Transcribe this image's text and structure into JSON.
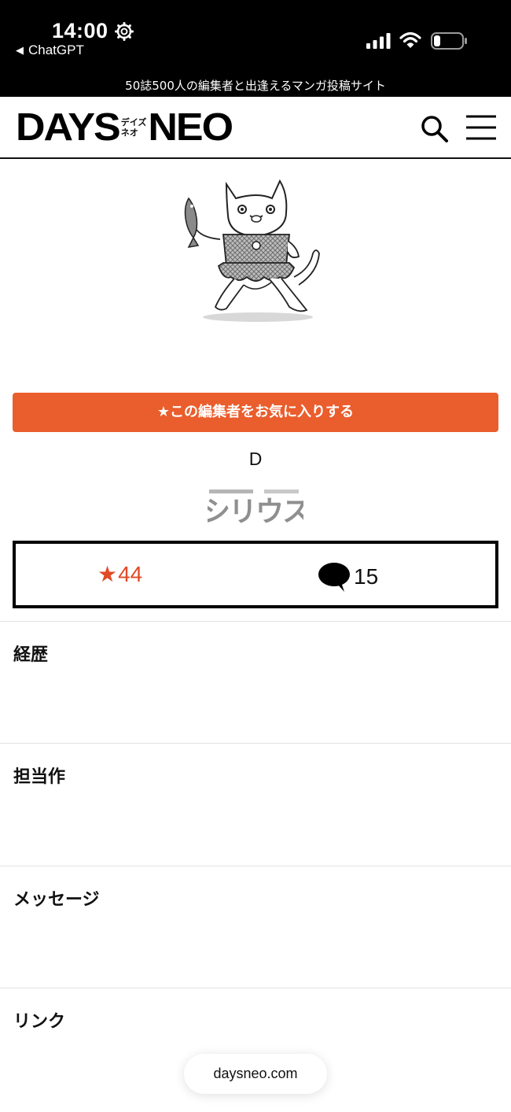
{
  "status_bar": {
    "time": "14:00",
    "back_app": "ChatGPT",
    "icons": [
      "gear-icon",
      "signal-icon",
      "wifi-icon",
      "battery-icon"
    ]
  },
  "site": {
    "tagline": "50誌500人の編集者と出逢えるマンガ投稿サイト",
    "logo_left": "DAYS",
    "logo_kana_top": "デイズ",
    "logo_kana_bottom": "ネオ",
    "logo_right": "NEO"
  },
  "editor": {
    "favorite_button_label": "★この編集者をお気に入りする",
    "name": "D",
    "magazine_logo": "シリウス",
    "favorites_count": "44",
    "comments_count": "15"
  },
  "sections": [
    {
      "title": "経歴"
    },
    {
      "title": "担当作"
    },
    {
      "title": "メッセージ"
    },
    {
      "title": "リンク"
    }
  ],
  "browser": {
    "domain": "daysneo.com"
  },
  "colors": {
    "accent": "#ea5d2c",
    "favorite_text": "#e04a27"
  }
}
